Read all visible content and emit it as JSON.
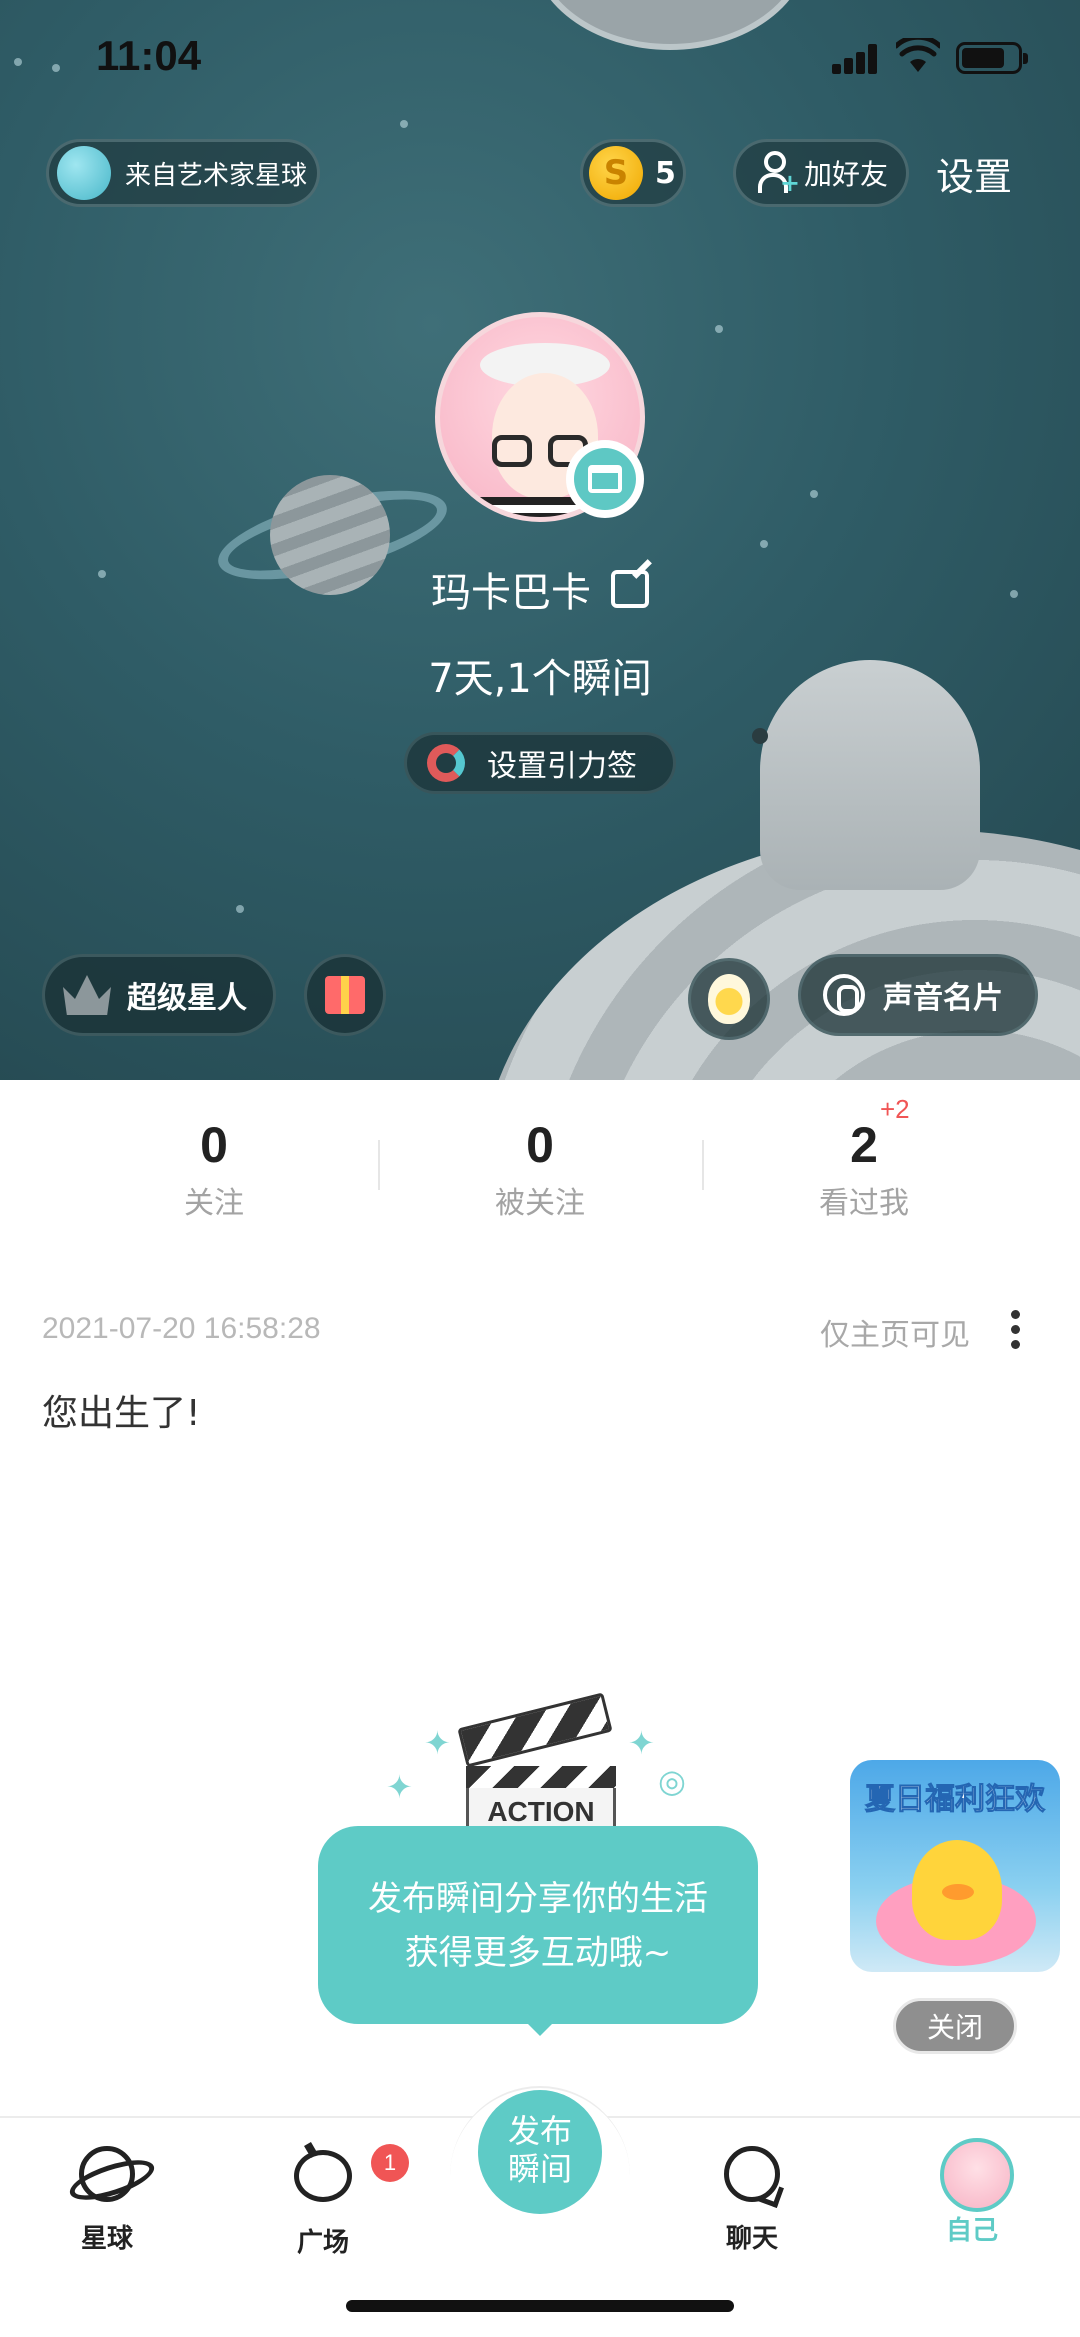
{
  "status_bar": {
    "time": "11:04"
  },
  "header": {
    "origin_label": "来自艺术家星球",
    "coin_count": "5",
    "coin_symbol": "S",
    "add_friend_label": "加好友",
    "settings_label": "设置"
  },
  "profile": {
    "username": "玛卡巴卡",
    "stats_line": "7天,1个瞬间",
    "gravity_tag_label": "设置引力签",
    "super_star_label": "超级星人",
    "voice_card_label": "声音名片"
  },
  "counters": {
    "following": {
      "value": "0",
      "label": "关注"
    },
    "followers": {
      "value": "0",
      "label": "被关注"
    },
    "viewed_me": {
      "value": "2",
      "label": "看过我",
      "badge": "+2"
    }
  },
  "post": {
    "timestamp": "2021-07-20 16:58:28",
    "visibility": "仅主页可见",
    "text": "您出生了!"
  },
  "publish_tip": {
    "clapper_text": "ACTION",
    "line1": "发布瞬间分享你的生活",
    "line2": "获得更多互动哦~"
  },
  "promo": {
    "title": "夏日福利狂欢",
    "close_label": "关闭"
  },
  "bottom_nav": {
    "planet_label": "星球",
    "square_label": "广场",
    "square_badge": "1",
    "publish_line1": "发布",
    "publish_line2": "瞬间",
    "chat_label": "聊天",
    "self_label": "自己"
  },
  "colors": {
    "accent": "#5ecbc6",
    "hero_background": "#2f5c66",
    "badge_red": "#f05555",
    "coin_gold": "#f0a800"
  },
  "icons": [
    "signal-icon",
    "wifi-icon",
    "battery-icon",
    "globe-icon",
    "coin-icon",
    "add-friend-icon",
    "shop-icon",
    "edit-icon",
    "magnet-icon",
    "crown-icon",
    "gift-icon",
    "egg-icon",
    "voice-icon",
    "more-icon",
    "planet-icon",
    "square-icon",
    "chat-icon"
  ]
}
